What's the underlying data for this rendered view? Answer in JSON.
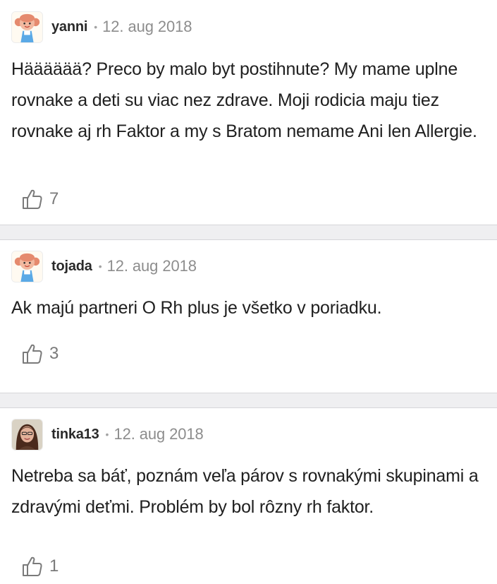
{
  "comments": [
    {
      "username": "yanni",
      "separator": "•",
      "timestamp": "12. aug 2018",
      "text": "Hääääää? Preco by malo byt postihnute? My mame uplne rovnake a deti su viac nez zdrave. Moji rodicia maju tiez rovnake aj rh Faktor a my s Bratom nemame Ani len Allergie.",
      "likes": "7",
      "avatar_icon": "cartoon-girl-avatar-icon"
    },
    {
      "username": "tojada",
      "separator": "•",
      "timestamp": "12. aug 2018",
      "text": "Ak majú partneri O Rh plus je všetko v poriadku.",
      "likes": "3",
      "avatar_icon": "cartoon-girl-avatar-icon"
    },
    {
      "username": "tinka13",
      "separator": "•",
      "timestamp": "12. aug 2018",
      "text": "Netreba sa báť, poznám veľa párov s rovnakými skupinami a zdravými deťmi. Problém by bol rôzny rh faktor.",
      "likes": "1",
      "avatar_icon": "user-photo-avatar"
    }
  ],
  "icons": {
    "like": "thumbs-up-outline-icon"
  },
  "colors": {
    "background": "#ffffff",
    "separator": "#efeff1",
    "username": "#2a2a2a",
    "timestamp": "#8d8d8d",
    "text": "#202020",
    "like": "#7a7a7a"
  }
}
